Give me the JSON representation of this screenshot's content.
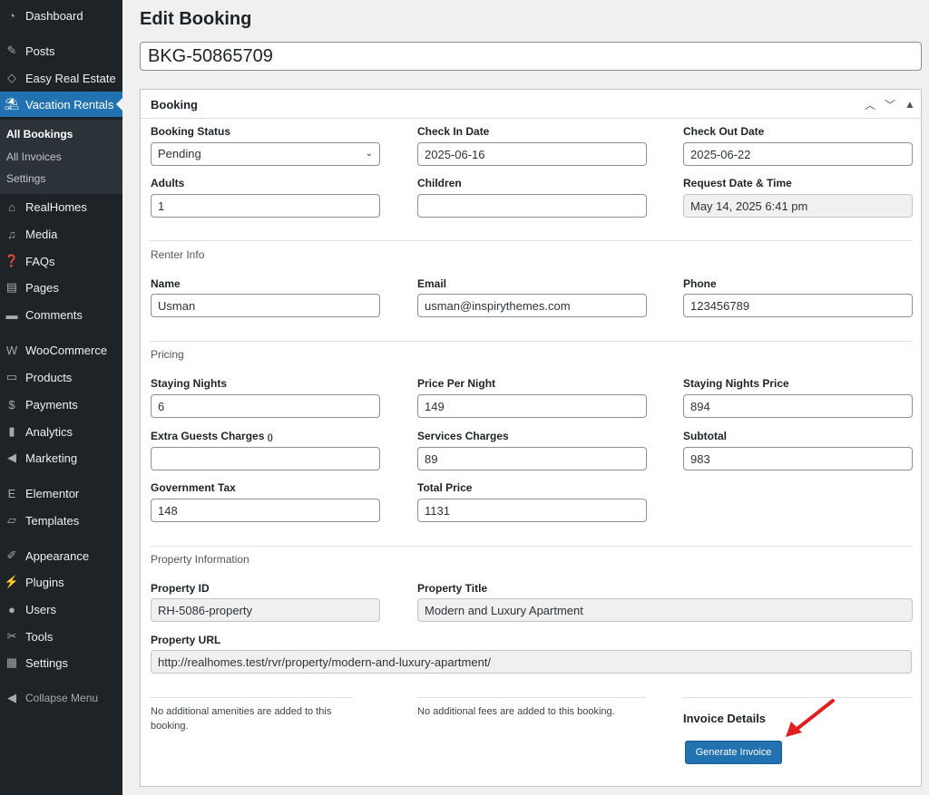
{
  "sidebar": {
    "items": [
      {
        "label": "Dashboard",
        "icon": "dashboard-icon",
        "glyph": "◔"
      },
      {
        "label": "Posts",
        "icon": "pin-icon",
        "glyph": "✎"
      },
      {
        "label": "Easy Real Estate",
        "icon": "diamond-icon",
        "glyph": "◇"
      },
      {
        "label": "Vacation Rentals",
        "icon": "vacation-icon",
        "glyph": "⛱"
      },
      {
        "label": "RealHomes",
        "icon": "house-icon",
        "glyph": "⌂"
      },
      {
        "label": "Media",
        "icon": "media-icon",
        "glyph": "♫"
      },
      {
        "label": "FAQs",
        "icon": "faq-icon",
        "glyph": "❓"
      },
      {
        "label": "Pages",
        "icon": "pages-icon",
        "glyph": "▤"
      },
      {
        "label": "Comments",
        "icon": "comment-icon",
        "glyph": "▬"
      },
      {
        "label": "WooCommerce",
        "icon": "woocommerce-icon",
        "glyph": "W"
      },
      {
        "label": "Products",
        "icon": "products-icon",
        "glyph": "▭"
      },
      {
        "label": "Payments",
        "icon": "payments-icon",
        "glyph": "$"
      },
      {
        "label": "Analytics",
        "icon": "analytics-icon",
        "glyph": "▮"
      },
      {
        "label": "Marketing",
        "icon": "megaphone-icon",
        "glyph": "◀"
      },
      {
        "label": "Elementor",
        "icon": "elementor-icon",
        "glyph": "E"
      },
      {
        "label": "Templates",
        "icon": "folder-icon",
        "glyph": "▱"
      },
      {
        "label": "Appearance",
        "icon": "brush-icon",
        "glyph": "✐"
      },
      {
        "label": "Plugins",
        "icon": "plugin-icon",
        "glyph": "⚡"
      },
      {
        "label": "Users",
        "icon": "user-icon",
        "glyph": "●"
      },
      {
        "label": "Tools",
        "icon": "wrench-icon",
        "glyph": "✂"
      },
      {
        "label": "Settings",
        "icon": "settings-icon",
        "glyph": "▦"
      }
    ],
    "submenu": [
      "All Bookings",
      "All Invoices",
      "Settings"
    ],
    "collapse": "Collapse Menu"
  },
  "page": {
    "title": "Edit Booking",
    "post_title": "BKG-50865709"
  },
  "box": {
    "title": "Booking",
    "booking_status": {
      "label": "Booking Status",
      "value": "Pending"
    },
    "check_in": {
      "label": "Check In Date",
      "value": "2025-06-16"
    },
    "check_out": {
      "label": "Check Out Date",
      "value": "2025-06-22"
    },
    "adults": {
      "label": "Adults",
      "value": "1"
    },
    "children": {
      "label": "Children",
      "value": ""
    },
    "request_date": {
      "label": "Request Date & Time",
      "value": "May 14, 2025 6:41 pm"
    },
    "renter_section": "Renter Info",
    "name": {
      "label": "Name",
      "value": "Usman"
    },
    "email": {
      "label": "Email",
      "value": "usman@inspirythemes.com"
    },
    "phone": {
      "label": "Phone",
      "value": "123456789"
    },
    "pricing_section": "Pricing",
    "staying_nights": {
      "label": "Staying Nights",
      "value": "6"
    },
    "price_per_night": {
      "label": "Price Per Night",
      "value": "149"
    },
    "staying_nights_price": {
      "label": "Staying Nights Price",
      "value": "894"
    },
    "extra_guests": {
      "label": "Extra Guests Charges",
      "suffix": "()",
      "value": ""
    },
    "services_charges": {
      "label": "Services Charges",
      "value": "89"
    },
    "subtotal": {
      "label": "Subtotal",
      "value": "983"
    },
    "gov_tax": {
      "label": "Government Tax",
      "value": "148"
    },
    "total_price": {
      "label": "Total Price",
      "value": "1131"
    },
    "property_section": "Property Information",
    "property_id": {
      "label": "Property ID",
      "value": "RH-5086-property"
    },
    "property_title": {
      "label": "Property Title",
      "value": "Modern and Luxury Apartment"
    },
    "property_url": {
      "label": "Property URL",
      "value": "http://realhomes.test/rvr/property/modern-and-luxury-apartment/"
    },
    "amenities_note": "No additional amenities are added to this booking.",
    "fees_note": "No additional fees are added to this booking.",
    "invoice_title": "Invoice Details",
    "generate_button": "Generate Invoice"
  },
  "colors": {
    "accent": "#2271b1",
    "sidebar": "#1d2327",
    "arrow": "#e02020"
  }
}
